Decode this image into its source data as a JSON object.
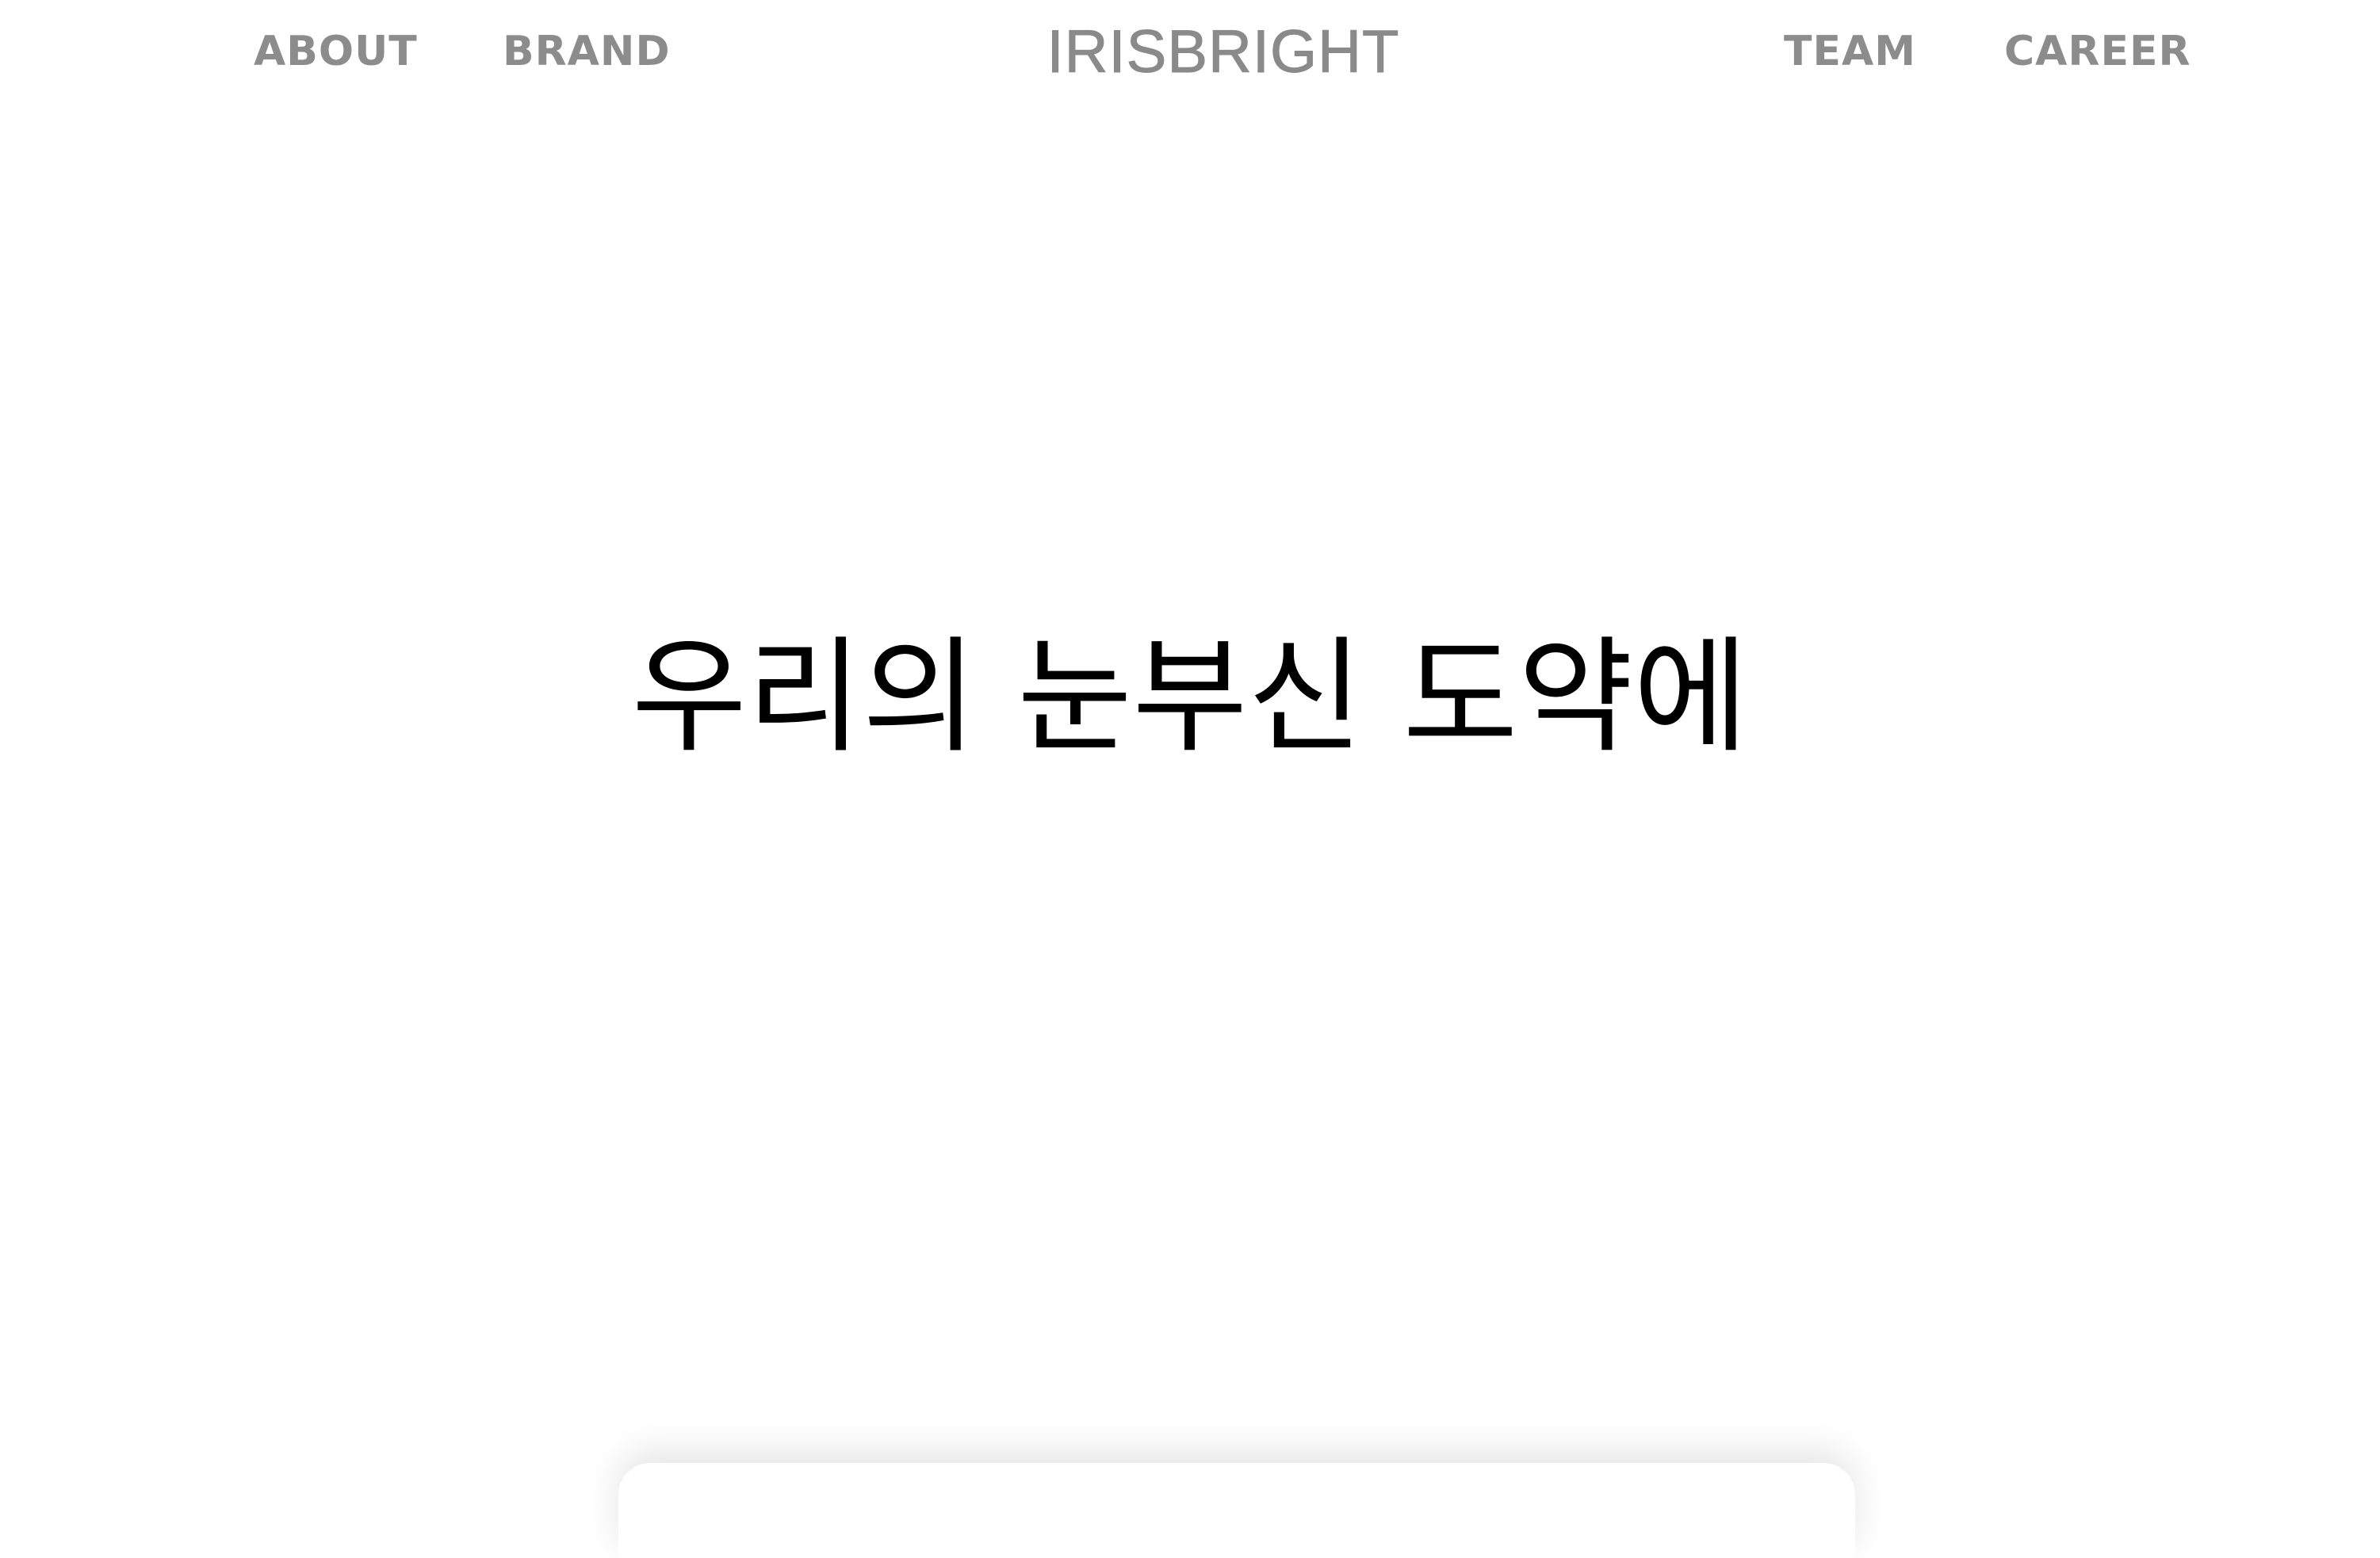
{
  "header": {
    "logo": "IRISBRIGHT",
    "left_links": [
      "ABOUT",
      "BRAND"
    ],
    "right_links": [
      "TEAM",
      "CAREER"
    ]
  },
  "hero": {
    "headline": "우리의 눈부신 도약에"
  },
  "colors": {
    "nav_text": "#8c8c8c",
    "logo_text": "#8a8a8a",
    "headline_text": "#000000",
    "background": "#ffffff"
  }
}
